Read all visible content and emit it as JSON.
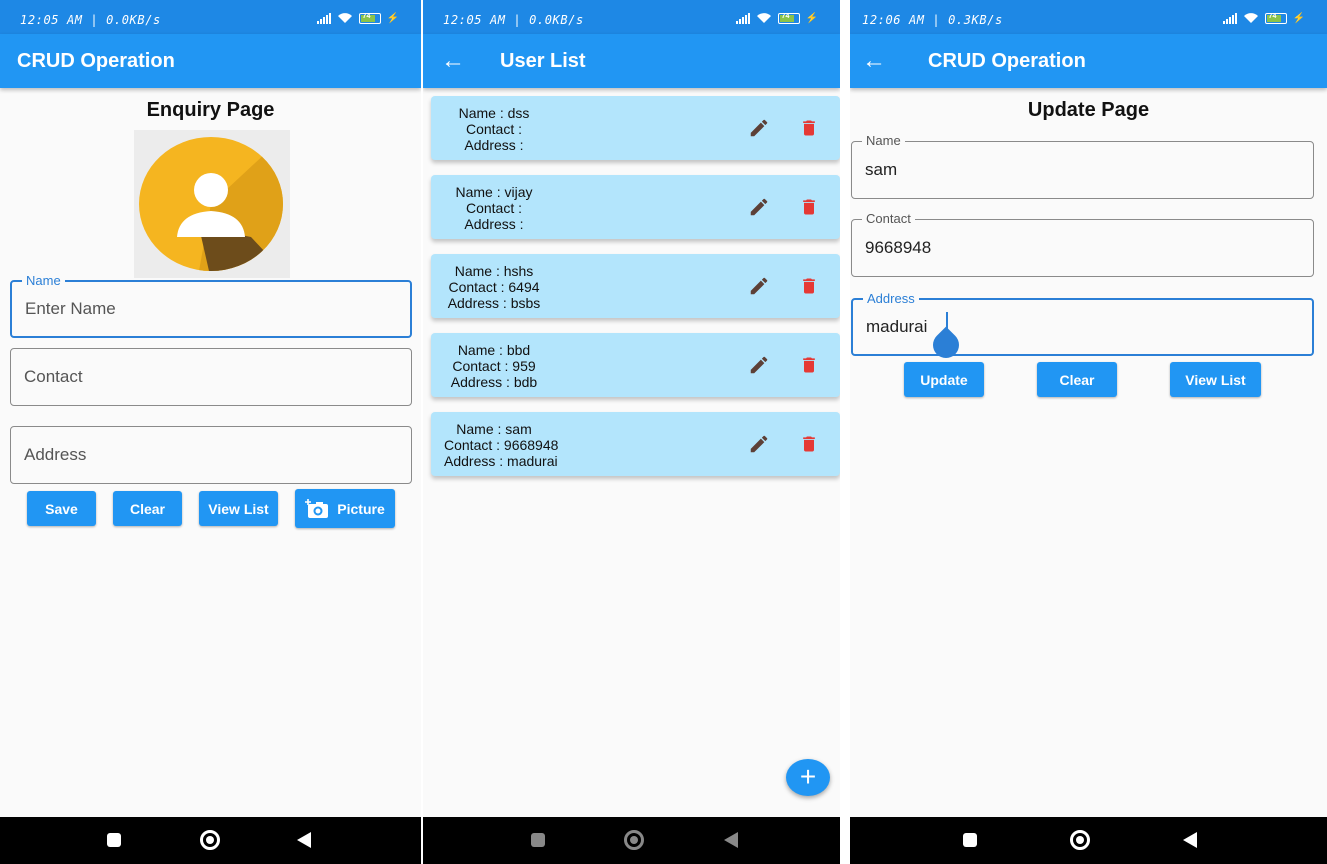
{
  "screen1": {
    "status_time": "12:05 AM | 0.0KB/s",
    "battery": "74",
    "appbar_title": "CRUD Operation",
    "heading": "Enquiry Page",
    "fields": {
      "name_label": "Name",
      "name_placeholder": "Enter Name",
      "contact_placeholder": "Contact",
      "address_placeholder": "Address"
    },
    "buttons": {
      "save": "Save",
      "clear": "Clear",
      "view_list": "View List",
      "picture": "Picture"
    }
  },
  "screen2": {
    "status_time": "12:05 AM | 0.0KB/s",
    "battery": "74",
    "appbar_title": "User List",
    "users": [
      {
        "name": "Name : dss",
        "contact": "Contact :",
        "address": "Address :"
      },
      {
        "name": "Name : vijay",
        "contact": "Contact :",
        "address": "Address :"
      },
      {
        "name": "Name : hshs",
        "contact": "Contact : 6494",
        "address": "Address : bsbs"
      },
      {
        "name": "Name : bbd",
        "contact": "Contact : 959",
        "address": "Address : bdb"
      },
      {
        "name": "Name : sam",
        "contact": "Contact : 9668948",
        "address": "Address : madurai"
      }
    ],
    "fab_icon": "+"
  },
  "screen3": {
    "status_time": "12:06 AM | 0.3KB/s",
    "battery": "74",
    "appbar_title": "CRUD Operation",
    "heading": "Update Page",
    "fields": {
      "name_label": "Name",
      "name_value": "sam",
      "contact_label": "Contact",
      "contact_value": "9668948",
      "address_label": "Address",
      "address_value": "madurai"
    },
    "buttons": {
      "update": "Update",
      "clear": "Clear",
      "view_list": "View List"
    }
  },
  "colors": {
    "appbar": "#2196f3",
    "statusbar": "#1e88e5",
    "card": "#b3e5fc",
    "delete": "#e53935",
    "edit": "#5d4037",
    "avatar": "#f5b520"
  },
  "icons": [
    "back-arrow-icon",
    "edit-icon",
    "delete-icon",
    "add-icon",
    "camera-icon",
    "avatar-icon"
  ]
}
